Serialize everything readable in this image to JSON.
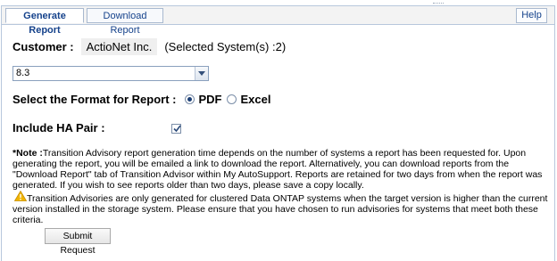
{
  "tabs": [
    {
      "label": "Generate Report",
      "active": true
    },
    {
      "label": "Download Report",
      "active": false
    }
  ],
  "help_label": "Help",
  "customer": {
    "label": "Customer :",
    "name": "ActioNet Inc.",
    "selected_systems": "(Selected System(s) :2)"
  },
  "version_select": {
    "value": "8.3"
  },
  "format": {
    "label": "Select the Format for Report :",
    "options": [
      {
        "label": "PDF",
        "selected": true
      },
      {
        "label": "Excel",
        "selected": false
      }
    ]
  },
  "ha_pair": {
    "label": "Include HA Pair :",
    "checked": true
  },
  "note": {
    "prefix": "*Note :",
    "text": "Transition Advisory report generation time depends on the number of systems a report has been requested for. Upon generating the report, you will be emailed a link to download the report. Alternatively, you can download reports from the \"Download Report\" tab of Transition Advisor within My AutoSupport. Reports are retained for two days from when the report was generated. If you wish to see reports older than two days, please save a copy locally."
  },
  "warning": {
    "icon": "warning-icon",
    "text": "Transition Advisories are only generated for clustered Data ONTAP systems when the target version is higher than the current version installed in the storage system. Please ensure that you have chosen to run advisories for systems that meet both these criteria."
  },
  "submit_label": "Submit Request",
  "colors": {
    "tab_text": "#15428b",
    "border": "#b7c7dc",
    "warning": "#f0b400"
  }
}
